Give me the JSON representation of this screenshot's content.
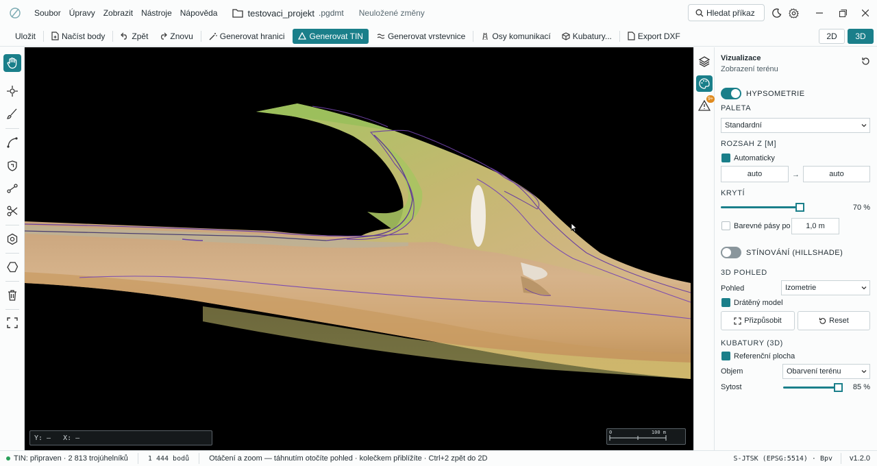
{
  "app": {
    "menu": [
      "Soubor",
      "Úpravy",
      "Zobrazit",
      "Nástroje",
      "Nápověda"
    ],
    "file_name": "testovaci_projekt",
    "file_ext": ".pgdmt",
    "unsaved": "Neuložené změny",
    "search_label": "Hledat příkaz"
  },
  "toolbar": {
    "save": "Uložit",
    "load_points": "Načíst body",
    "undo": "Zpět",
    "redo": "Znovu",
    "gen_boundary": "Generovat hranici",
    "gen_tin": "Generovat TIN",
    "gen_contours": "Generovat vrstevnice",
    "road_axes": "Osy komunikací",
    "volumes": "Kubatury...",
    "export_dxf": "Export DXF",
    "view_2d": "2D",
    "view_3d": "3D"
  },
  "left_tools": [
    "hand-icon",
    "point-icon",
    "brush-icon",
    "curve-icon",
    "shield-icon",
    "link-icon",
    "scissors-icon",
    "gear-hex-icon",
    "polygon-icon",
    "trash-icon",
    "fit-icon"
  ],
  "viewport": {
    "coord_y": "Y: —",
    "coord_x": "X: —",
    "scale_start": "0",
    "scale_end": "100 m"
  },
  "right_strip": {
    "warning_badge": "9+"
  },
  "panel": {
    "title": "Vizualizace",
    "subtitle": "Zobrazení terénu",
    "hypsometry_label": "HYPSOMETRIE",
    "hypsometry_on": true,
    "palette_label": "PALETA",
    "palette_value": "Standardní",
    "range_label": "ROZSAH Z [M]",
    "auto_label": "Automaticky",
    "range_min": "auto",
    "range_max": "auto",
    "range_arrow": "→",
    "opacity_label": "KRYTÍ",
    "opacity_value": 70,
    "opacity_text": "70 %",
    "bands_label": "Barevné pásy po",
    "bands_value": "1,0 m",
    "hillshade_label": "STÍNOVÁNÍ (HILLSHADE)",
    "hillshade_on": false,
    "view3d_label": "3D POHLED",
    "view_label": "Pohled",
    "view_value": "Izometrie",
    "wireframe_label": "Drátěný model",
    "fit_btn": "Přizpůsobit",
    "reset_btn": "Reset",
    "volumes_label": "KUBATURY (3D)",
    "refsurface_label": "Referenční plocha",
    "volume_label": "Objem",
    "volume_value": "Obarvení terénu",
    "saturation_label": "Sytost",
    "saturation_value": 85,
    "saturation_text": "85 %"
  },
  "status": {
    "tin": "TIN: připraven · 2 813 trojúhelníků",
    "points": "1 444 bodů",
    "hint": "Otáčení a zoom — táhnutím otočíte pohled · kolečkem přiblížíte · Ctrl+2 zpět do 2D",
    "crs": "S-JTSK (EPSG:5514) · Bpv",
    "version": "v1.2.0"
  },
  "colors": {
    "accent": "#1a7f8a",
    "terrain_light": "#d8b48c",
    "terrain_green": "#9cc060",
    "contour": "#6a3fa0"
  }
}
